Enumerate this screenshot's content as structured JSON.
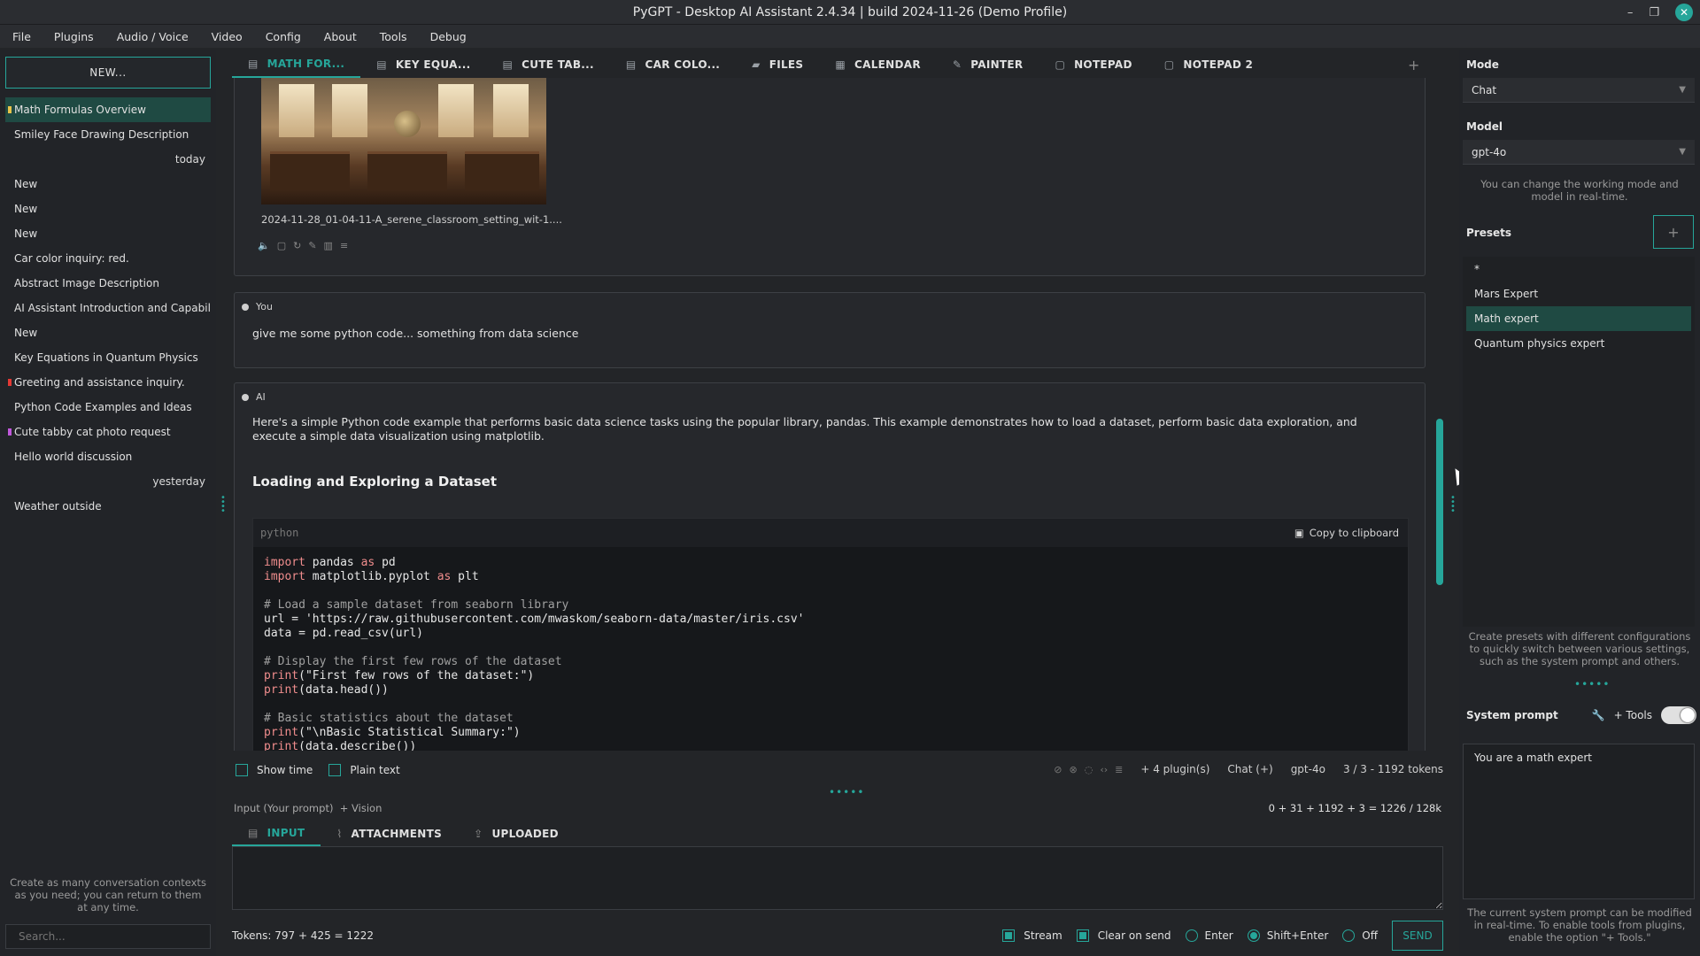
{
  "window": {
    "title": "PyGPT - Desktop AI Assistant 2.4.34 | build 2024-11-26 (Demo Profile)"
  },
  "menu": [
    "File",
    "Plugins",
    "Audio / Voice",
    "Video",
    "Config",
    "About",
    "Tools",
    "Debug"
  ],
  "sidebar": {
    "new_label": "NEW...",
    "items": [
      {
        "label": "Math Formulas Overview",
        "type": "item",
        "active": true,
        "mark": "#e6c34a"
      },
      {
        "label": "Smiley Face Drawing Description",
        "type": "item"
      },
      {
        "label": "today",
        "type": "group"
      },
      {
        "label": "New",
        "type": "item"
      },
      {
        "label": "New",
        "type": "item"
      },
      {
        "label": "New",
        "type": "item"
      },
      {
        "label": "Car color inquiry: red.",
        "type": "item"
      },
      {
        "label": "Abstract Image Description",
        "type": "item"
      },
      {
        "label": "AI Assistant Introduction and Capabili...",
        "type": "item"
      },
      {
        "label": "New",
        "type": "item"
      },
      {
        "label": "Key Equations in Quantum Physics",
        "type": "item"
      },
      {
        "label": "Greeting and assistance inquiry.",
        "type": "item",
        "mark": "#e53935"
      },
      {
        "label": "Python Code Examples and Ideas",
        "type": "item"
      },
      {
        "label": "Cute tabby cat photo request",
        "type": "item",
        "mark": "#c158dc"
      },
      {
        "label": "Hello world discussion",
        "type": "item"
      },
      {
        "label": "yesterday",
        "type": "group"
      },
      {
        "label": "Weather outside",
        "type": "item"
      }
    ],
    "hint": "Create as many conversation contexts as you need; you can return to them at any time.",
    "search_placeholder": "Search..."
  },
  "tabs": [
    {
      "label": "MATH FOR...",
      "icon": "chat-icon",
      "active": true
    },
    {
      "label": "KEY EQUA...",
      "icon": "chat-icon"
    },
    {
      "label": "CUTE TAB...",
      "icon": "chat-icon"
    },
    {
      "label": "CAR COLO...",
      "icon": "chat-icon"
    },
    {
      "label": "FILES",
      "icon": "folder-icon"
    },
    {
      "label": "CALENDAR",
      "icon": "calendar-icon"
    },
    {
      "label": "PAINTER",
      "icon": "brush-icon"
    },
    {
      "label": "NOTEPAD",
      "icon": "note-icon"
    },
    {
      "label": "NOTEPAD 2",
      "icon": "note-icon"
    }
  ],
  "chat": {
    "image_caption": "2024-11-28_01-04-11-A_serene_classroom_setting_wit-1....",
    "user_sender": "You",
    "user_message": "give me some python code... something from data science",
    "ai_sender": "AI",
    "ai_intro": "Here's a simple Python code example that performs basic data science tasks using the popular library, pandas. This example demonstrates how to load a dataset, perform basic data exploration, and execute a simple data visualization using matplotlib.",
    "ai_heading": "Loading and Exploring a Dataset",
    "code_lang": "python",
    "copy_label": "Copy to clipboard"
  },
  "status": {
    "show_time": "Show time",
    "plain_text": "Plain text",
    "plugins": "+ 4 plugin(s)",
    "mode": "Chat (+)",
    "model": "gpt-4o",
    "tokens": "3 / 3 - 1192 tokens"
  },
  "input": {
    "label": "Input (Your prompt)",
    "vision": "+ Vision",
    "token_summary": "0 + 31 + 1192 + 3 = 1226 / 128k",
    "tabs": [
      {
        "label": "INPUT",
        "icon": "chat-icon",
        "active": true
      },
      {
        "label": "ATTACHMENTS",
        "icon": "paperclip-icon"
      },
      {
        "label": "UPLOADED",
        "icon": "upload-icon"
      }
    ],
    "tokens_text": "Tokens: 797 + 425 = 1222",
    "stream": "Stream",
    "clear_on_send": "Clear on send",
    "enter": "Enter",
    "shift_enter": "Shift+Enter",
    "off": "Off",
    "send": "SEND"
  },
  "right": {
    "mode_label": "Mode",
    "mode_value": "Chat",
    "model_label": "Model",
    "model_value": "gpt-4o",
    "mode_hint": "You can change the working mode and model in real-time.",
    "presets_label": "Presets",
    "presets": [
      "*",
      "Mars Expert",
      "Math expert",
      "Quantum physics expert"
    ],
    "presets_active": 2,
    "presets_hint": "Create presets with different configurations to quickly switch between various settings, such as the system prompt and others.",
    "system_prompt_label": "System prompt",
    "tools_label": "+ Tools",
    "system_prompt_value": "You are a math expert",
    "system_hint": "The current system prompt can be modified in real-time. To enable tools from plugins, enable the option \"+ Tools.\""
  },
  "colors": {
    "accent": "#26a69a",
    "active_bg": "#1f4a43"
  }
}
